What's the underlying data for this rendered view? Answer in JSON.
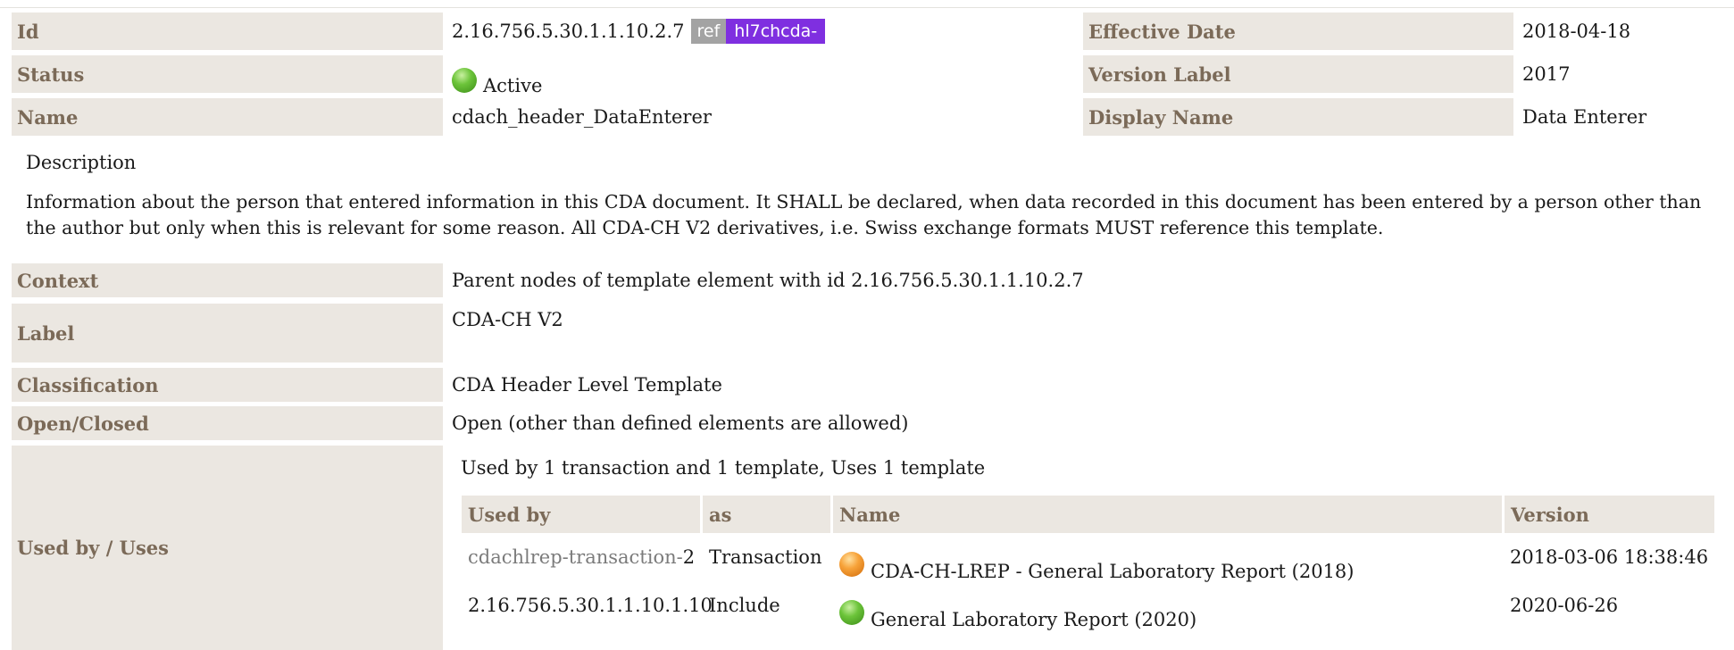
{
  "meta": {
    "id_label": "Id",
    "id_value": "2.16.756.5.30.1.1.10.2.7",
    "ref_badge": "ref",
    "version_badge": "hl7chcda-",
    "effective_date_label": "Effective Date",
    "effective_date_value": "2018-04-18",
    "status_label": "Status",
    "status_value": "Active",
    "status_color": "#5cb82a",
    "version_label_label": "Version Label",
    "version_label_value": "2017",
    "name_label": "Name",
    "name_value": "cdach_header_DataEnterer",
    "display_name_label": "Display Name",
    "display_name_value": "Data Enterer"
  },
  "description": {
    "title": "Description",
    "text": "Information about the person that entered information in this CDA document. It SHALL be declared, when data recorded in this document has been entered by a person other than the author but only when this is relevant for some reason. All CDA-CH V2 derivatives, i.e. Swiss exchange formats MUST reference this template."
  },
  "details": {
    "context_label": "Context",
    "context_value": "Parent nodes of template element with id 2.16.756.5.30.1.1.10.2.7",
    "label_label": "Label",
    "label_value": "CDA-CH V2",
    "classification_label": "Classification",
    "classification_value": "CDA Header Level Template",
    "open_closed_label": "Open/Closed",
    "open_closed_value": "Open (other than defined elements are allowed)",
    "used_by_label": "Used by / Uses",
    "used_by_summary": "Used by 1 transaction and 1 template, Uses 1 template"
  },
  "usage_table": {
    "headers": {
      "used_by": "Used by",
      "as": "as",
      "name": "Name",
      "version": "Version"
    },
    "rows": [
      {
        "used_by_prefix": "cdachlrep-transaction-",
        "used_by_suffix": "2",
        "as": "Transaction",
        "status_icon": "orange-status-ball-icon",
        "name": "CDA-CH-LREP - General Laboratory Report (2018)",
        "version": "2018-03-06 18:38:46"
      },
      {
        "used_by_prefix": "2.16.756.5.30.1.1.10.1.10",
        "used_by_suffix": "",
        "as": "Include",
        "status_icon": "green-status-ball-icon",
        "name": "General Laboratory Report (2020)",
        "version": "2020-06-26"
      }
    ]
  },
  "colors": {
    "label_bg": "#ebe7e1",
    "label_text": "#7b6a58",
    "ref_badge_bg": "#a3a3a3",
    "version_badge_bg": "#7f2fe0"
  }
}
